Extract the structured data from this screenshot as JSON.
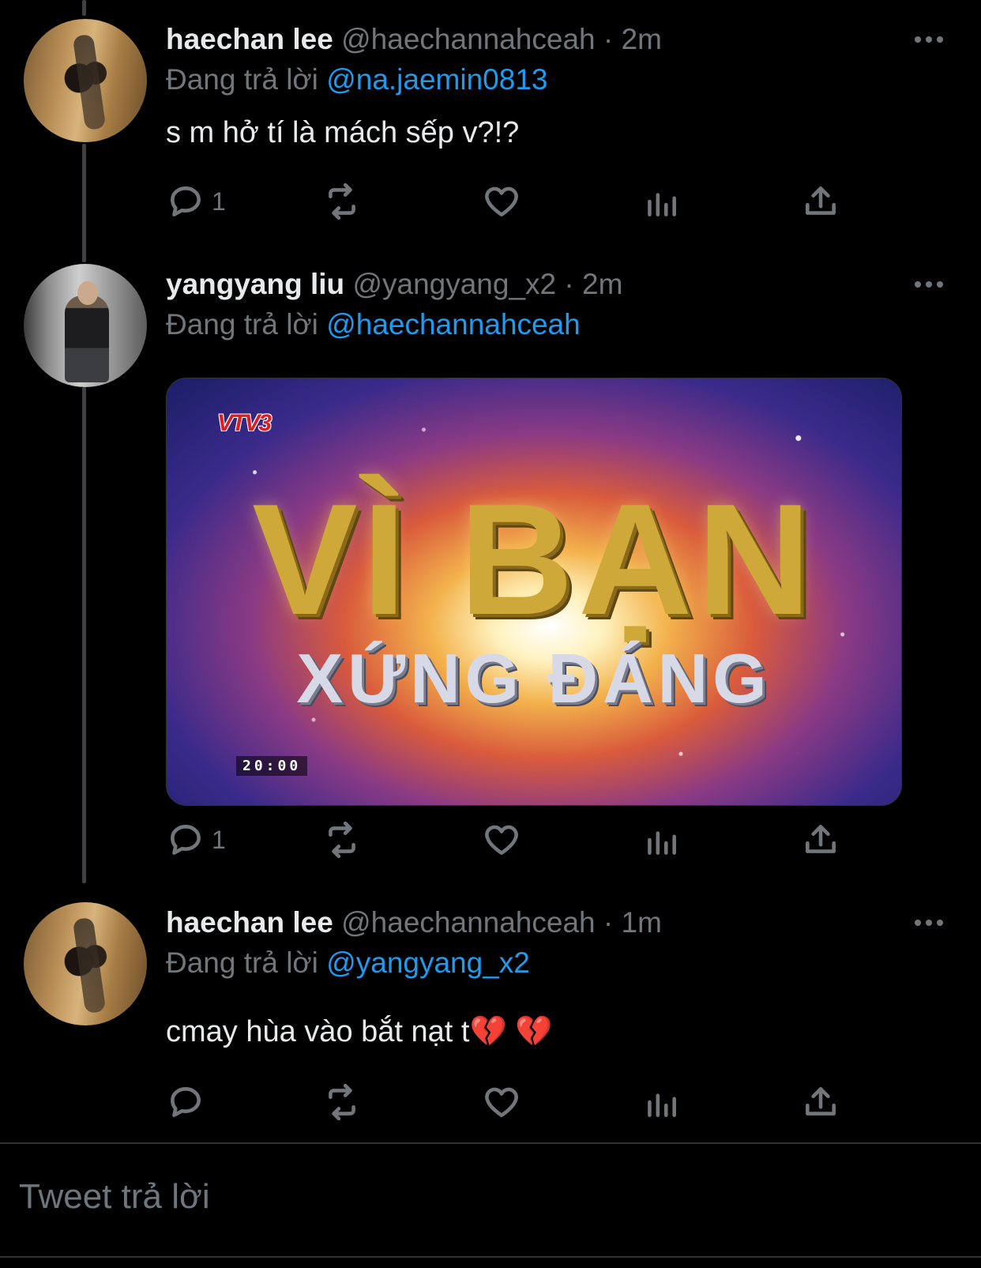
{
  "tweets": [
    {
      "name": "haechan lee",
      "handle": "@haechannahceah",
      "sep": "·",
      "time": "2m",
      "replying_prefix": "Đang trả lời",
      "replying_to": "@na.jaemin0813",
      "text": "s m hở tí là mách sếp v?!?",
      "reply_count": "1",
      "avatar_icon": "avatar-photo"
    },
    {
      "name": "yangyang liu",
      "handle": "@yangyang_x2",
      "sep": "·",
      "time": "2m",
      "replying_prefix": "Đang trả lời",
      "replying_to": "@haechannahceah",
      "media": {
        "logo": "VTV3",
        "title_line1": "VÌ BẠN",
        "title_line2": "XỨNG ĐÁNG",
        "timestamp": "20:00"
      },
      "reply_count": "1",
      "avatar_icon": "avatar-photo"
    },
    {
      "name": "haechan lee",
      "handle": "@haechannahceah",
      "sep": "·",
      "time": "1m",
      "replying_prefix": "Đang trả lời",
      "replying_to": "@yangyang_x2",
      "text": "cmay hùa vào bắt nạt t💔 💔",
      "reply_count": "",
      "avatar_icon": "avatar-photo"
    }
  ],
  "compose": {
    "placeholder": "Tweet trả lời"
  },
  "colors": {
    "background": "#000000",
    "text": "#e7e9ea",
    "muted": "#71767b",
    "accent": "#1d9bf0"
  },
  "icons": [
    "reply-icon",
    "retweet-icon",
    "like-icon",
    "analytics-icon",
    "share-icon",
    "more-icon"
  ]
}
